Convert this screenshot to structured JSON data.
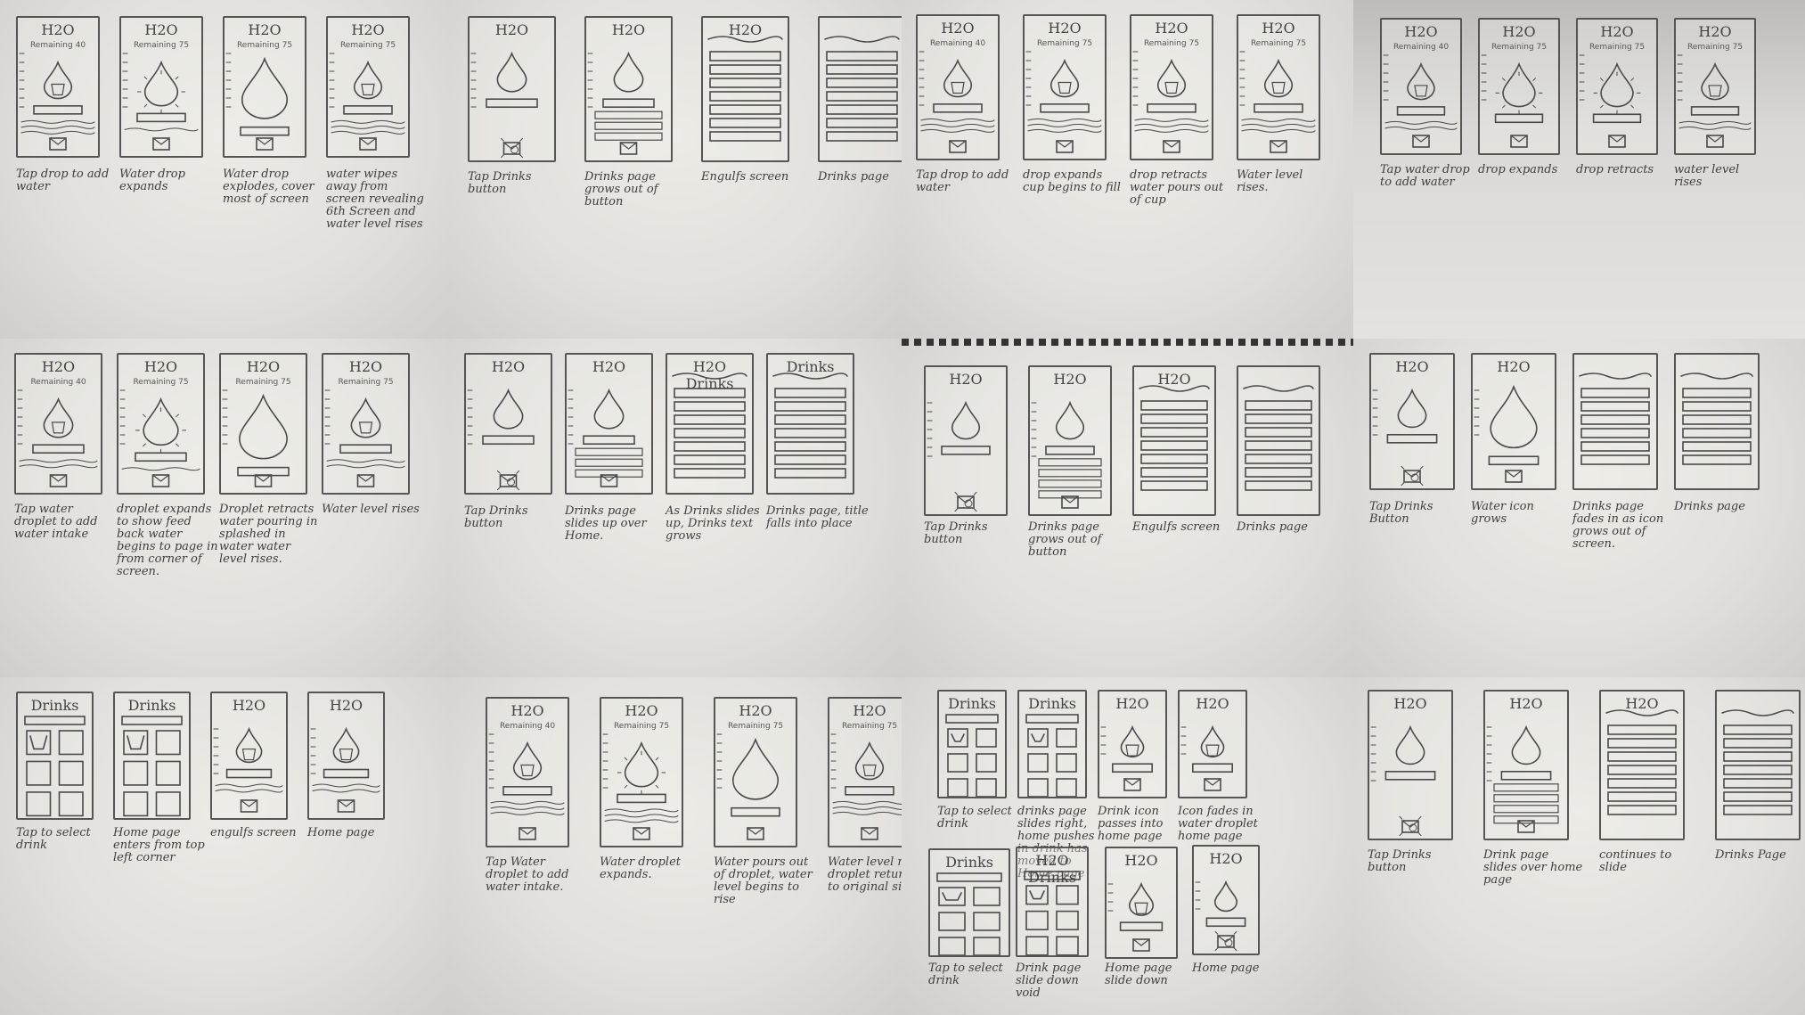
{
  "sheets": [
    {
      "frames": [
        {
          "title": "H2O",
          "sub": "Remaining 40",
          "kind": "drop-cup",
          "caption": "Tap drop to add water"
        },
        {
          "title": "H2O",
          "sub": "Remaining 75",
          "kind": "drop-expand",
          "caption": "Water drop expands"
        },
        {
          "title": "H2O",
          "sub": "Remaining 75",
          "kind": "drop-big",
          "caption": "Water drop explodes, cover most of screen"
        },
        {
          "title": "H2O",
          "sub": "Remaining 75",
          "kind": "drop-level",
          "caption": "water wipes away from screen revealing 6th Screen and water level rises"
        }
      ]
    },
    {
      "frames": [
        {
          "title": "H2O",
          "sub": "",
          "kind": "drop-tap",
          "caption": "Tap Drinks button"
        },
        {
          "title": "H2O",
          "sub": "",
          "kind": "drop-slide",
          "caption": "Drinks page grows out of button"
        },
        {
          "title": "H2O",
          "sub": "",
          "kind": "list",
          "caption": "Engulfs screen"
        },
        {
          "title": "",
          "sub": "",
          "kind": "list",
          "caption": "Drinks page"
        }
      ]
    },
    {
      "frames": [
        {
          "title": "H2O",
          "sub": "Remaining 40",
          "kind": "drop-cup",
          "caption": "Tap drop to add water"
        },
        {
          "title": "H2O",
          "sub": "Remaining 75",
          "kind": "drop-cup",
          "caption": "drop expands cup begins to fill"
        },
        {
          "title": "H2O",
          "sub": "Remaining 75",
          "kind": "drop-cup",
          "caption": "drop retracts water pours out of cup"
        },
        {
          "title": "H2O",
          "sub": "Remaining 75",
          "kind": "drop-level",
          "caption": "Water level rises."
        }
      ]
    },
    {
      "frames": [
        {
          "title": "H2O",
          "sub": "Remaining 40",
          "kind": "drop-cup",
          "caption": "Tap water drop to add water"
        },
        {
          "title": "H2O",
          "sub": "Remaining 75",
          "kind": "drop-expand",
          "caption": "drop expands"
        },
        {
          "title": "H2O",
          "sub": "Remaining 75",
          "kind": "drop-expand",
          "caption": "drop retracts"
        },
        {
          "title": "H2O",
          "sub": "Remaining 75",
          "kind": "drop-level",
          "caption": "water level rises"
        }
      ]
    },
    {
      "frames": [
        {
          "title": "H2O",
          "sub": "Remaining 40",
          "kind": "drop-cup",
          "caption": "Tap water droplet to add water intake"
        },
        {
          "title": "H2O",
          "sub": "Remaining 75",
          "kind": "drop-expand",
          "caption": "droplet expands to show feed back water begins to page in from corner of screen."
        },
        {
          "title": "H2O",
          "sub": "Remaining 75",
          "kind": "drop-big",
          "caption": "Droplet retracts water pouring in splashed in water water level rises."
        },
        {
          "title": "H2O",
          "sub": "Remaining 75",
          "kind": "drop-level",
          "caption": "Water level rises"
        }
      ]
    },
    {
      "frames": [
        {
          "title": "H2O",
          "sub": "",
          "kind": "drop-tap",
          "caption": "Tap Drinks button"
        },
        {
          "title": "H2O",
          "sub": "",
          "kind": "drop-slide",
          "caption": "Drinks page slides up over Home."
        },
        {
          "title": "H2O Drinks",
          "sub": "",
          "kind": "list",
          "caption": "As Drinks slides up, Drinks text grows"
        },
        {
          "title": "Drinks",
          "sub": "",
          "kind": "list",
          "caption": "Drinks page, title falls into place"
        }
      ]
    },
    {
      "frames": [
        {
          "title": "H2O",
          "sub": "",
          "kind": "drop-tap",
          "caption": "Tap Drinks button"
        },
        {
          "title": "H2O",
          "sub": "",
          "kind": "drop-slide",
          "caption": "Drinks page grows out of button"
        },
        {
          "title": "H2O",
          "sub": "",
          "kind": "list",
          "caption": "Engulfs screen"
        },
        {
          "title": "",
          "sub": "",
          "kind": "list",
          "caption": "Drinks page"
        }
      ]
    },
    {
      "frames": [
        {
          "title": "H2O",
          "sub": "",
          "kind": "drop-tap",
          "caption": "Tap Drinks Button"
        },
        {
          "title": "H2O",
          "sub": "",
          "kind": "drop-big",
          "caption": "Water icon grows"
        },
        {
          "title": "",
          "sub": "",
          "kind": "list",
          "caption": "Drinks page fades in as icon grows out of screen."
        },
        {
          "title": "",
          "sub": "",
          "kind": "list",
          "caption": "Drinks page"
        }
      ]
    },
    {
      "frames": [
        {
          "title": "Drinks",
          "sub": "",
          "kind": "grid",
          "caption": "Tap to select drink"
        },
        {
          "title": "Drinks",
          "sub": "",
          "kind": "grid",
          "caption": "Home page enters from top left corner"
        },
        {
          "title": "H2O",
          "sub": "",
          "kind": "drop-cup",
          "caption": "engulfs screen"
        },
        {
          "title": "H2O",
          "sub": "",
          "kind": "drop-cup",
          "caption": "Home page"
        }
      ]
    },
    {
      "frames": [
        {
          "title": "H2O",
          "sub": "Remaining 40",
          "kind": "drop-cup",
          "caption": "Tap Water droplet to add water intake."
        },
        {
          "title": "H2O",
          "sub": "Remaining 75",
          "kind": "drop-expand",
          "caption": "Water droplet expands."
        },
        {
          "title": "H2O",
          "sub": "Remaining 75",
          "kind": "drop-big",
          "caption": "Water pours out of droplet, water level begins to rise"
        },
        {
          "title": "H2O",
          "sub": "Remaining 75",
          "kind": "drop-level",
          "caption": "Water level rises droplet returns to original size"
        }
      ]
    },
    {
      "frames": [
        {
          "title": "Drinks",
          "sub": "",
          "kind": "grid",
          "caption": "Tap to select drink"
        },
        {
          "title": "Drinks",
          "sub": "",
          "kind": "grid",
          "caption": "drinks page slides right, home pushes in drink has moved to Home page"
        },
        {
          "title": "H2O",
          "sub": "",
          "kind": "drop-cup",
          "caption": "Drink icon passes into home page"
        },
        {
          "title": "H2O",
          "sub": "",
          "kind": "drop-cup",
          "caption": "Icon fades in water droplet home page"
        },
        {
          "title": "Drinks",
          "sub": "",
          "kind": "grid",
          "caption": "Tap to select drink"
        },
        {
          "title": "H2O Drinks",
          "sub": "",
          "kind": "grid",
          "caption": "Drink page slide down void"
        },
        {
          "title": "H2O",
          "sub": "",
          "kind": "drop-cup",
          "caption": "Home page slide down"
        },
        {
          "title": "H2O",
          "sub": "",
          "kind": "drop-tap",
          "caption": "Home page"
        }
      ]
    },
    {
      "frames": [
        {
          "title": "H2O",
          "sub": "",
          "kind": "drop-tap",
          "caption": "Tap Drinks button"
        },
        {
          "title": "H2O",
          "sub": "",
          "kind": "drop-slide",
          "caption": "Drink page slides over home page"
        },
        {
          "title": "H2O",
          "sub": "",
          "kind": "list",
          "caption": "continues to slide"
        },
        {
          "title": "",
          "sub": "",
          "kind": "list",
          "caption": "Drinks Page"
        }
      ]
    }
  ]
}
